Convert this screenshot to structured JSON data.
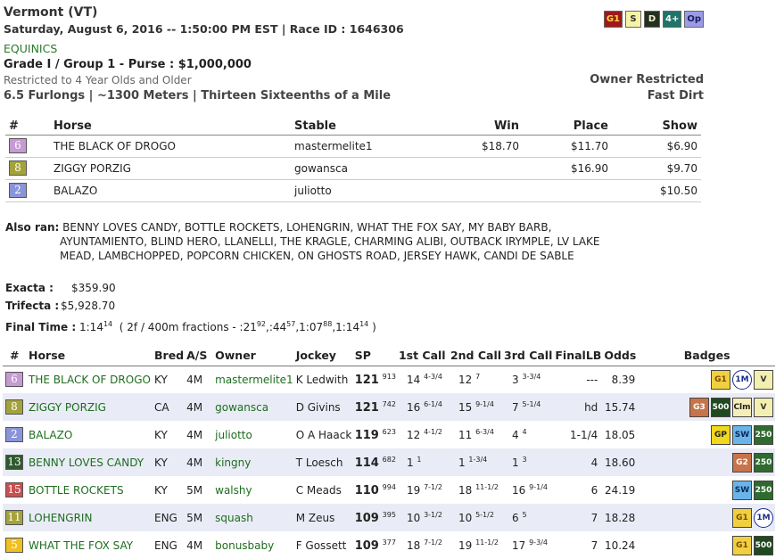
{
  "header": {
    "title": "Vermont (VT)",
    "subtitle": "Saturday, August 6, 2016 -- 1:50:00 PM EST | Race ID : 1646306",
    "grade_badges": [
      {
        "label": "G1",
        "bg": "#a01818",
        "fg": "#ffd24a"
      },
      {
        "label": "S",
        "bg": "#f6f3a6",
        "fg": "#333"
      },
      {
        "label": "D",
        "bg": "#24301e",
        "fg": "#f0f0d0"
      },
      {
        "label": "4+",
        "bg": "#1f7468",
        "fg": "#ffffff"
      },
      {
        "label": "Op",
        "bg": "#9a9ce6",
        "fg": "#1a1a60"
      }
    ],
    "track": "EQUINICS",
    "purse": "Grade I / Group 1 - Purse : $1,000,000",
    "restriction": "Restricted to 4 Year Olds and Older",
    "distance": "6.5 Furlongs | ~1300 Meters | Thirteen Sixteenths of a Mile",
    "owner_restricted": "Owner Restricted",
    "surface": "Fast Dirt"
  },
  "results": {
    "headers": [
      "#",
      "Horse",
      "Stable",
      "Win",
      "Place",
      "Show"
    ],
    "rows": [
      {
        "pp": "6",
        "color": "#c69ad2",
        "horse": "THE BLACK OF DROGO",
        "stable": "mastermelite1",
        "win": "$18.70",
        "place": "$11.70",
        "show": "$6.90"
      },
      {
        "pp": "8",
        "color": "#a4a33a",
        "horse": "ZIGGY PORZIG",
        "stable": "gowansca",
        "win": "",
        "place": "$16.90",
        "show": "$9.70"
      },
      {
        "pp": "2",
        "color": "#8a94d8",
        "horse": "BALAZO",
        "stable": "juliotto",
        "win": "",
        "place": "",
        "show": "$10.50"
      }
    ]
  },
  "also_ran": {
    "label": "Also ran:",
    "lines": [
      "BENNY LOVES CANDY, BOTTLE ROCKETS, LOHENGRIN, WHAT THE FOX SAY, MY BABY BARB,",
      "AYUNTAMIENTO, BLIND HERO, LLANELLI, THE KRAGLE, CHARMING ALIBI, OUTBACK IRYMPLE, LV LAKE",
      "MEAD, LAMBCHOPPED, POPCORN CHICKEN, ON GHOSTS ROAD, JERSEY HAWK, CANDI DE SABLE"
    ]
  },
  "exotics": {
    "exacta_label": "Exacta :",
    "exacta_value": "$359.90",
    "trifecta_label": "Trifecta :",
    "trifecta_value": "$5,928.70"
  },
  "final_time": {
    "label": "Final Time :",
    "time": "1:14",
    "time_sup": "14",
    "fractions_prefix": "( 2f / 400m fractions - :21",
    "f1_sup": "92",
    "f2": ",:44",
    "f2_sup": "57",
    "f3": ",1:07",
    "f3_sup": "88",
    "f4": ",1:14",
    "f4_sup": "14",
    "close": ")"
  },
  "main_table": {
    "headers": [
      "#",
      "Horse",
      "Bred",
      "A/S",
      "Owner",
      "Jockey",
      "SP",
      "1st Call",
      "2nd Call",
      "3rd Call",
      "FinalLB",
      "Odds",
      "Badges"
    ],
    "rows": [
      {
        "pp": "6",
        "color": "#c69ad2",
        "horse": "THE BLACK OF DROGO",
        "bred": "KY",
        "as": "4M",
        "owner": "mastermelite1",
        "jockey": "K Ledwith",
        "sp": "121",
        "sp_sup": "913",
        "c1": "14",
        "c1s": "4-3/4",
        "c2": "12",
        "c2s": "7",
        "c3": "3",
        "c3s": "3-3/4",
        "flb": "---",
        "odds": "8.39",
        "badges": [
          {
            "t": "G1",
            "bg": "#f0d040",
            "fg": "#7a4a00"
          },
          {
            "t": "1M",
            "bg": "#ffffff",
            "fg": "#1a2a8a"
          },
          {
            "t": "V",
            "bg": "#f3efb0",
            "fg": "#333"
          }
        ]
      },
      {
        "pp": "8",
        "color": "#a4a33a",
        "horse": "ZIGGY PORZIG",
        "bred": "CA",
        "as": "4M",
        "owner": "gowansca",
        "jockey": "D Givins",
        "sp": "121",
        "sp_sup": "742",
        "c1": "16",
        "c1s": "6-1/4",
        "c2": "15",
        "c2s": "9-1/4",
        "c3": "7",
        "c3s": "5-1/4",
        "flb": "hd",
        "odds": "15.74",
        "badges": [
          {
            "t": "G3",
            "bg": "#c8744a",
            "fg": "#fff"
          },
          {
            "t": "500",
            "bg": "#1f4a1f",
            "fg": "#fff"
          },
          {
            "t": "Clm",
            "bg": "#f6eeb8",
            "fg": "#222"
          },
          {
            "t": "V",
            "bg": "#f3efb0",
            "fg": "#333"
          }
        ]
      },
      {
        "pp": "2",
        "color": "#8a94d8",
        "horse": "BALAZO",
        "bred": "KY",
        "as": "4M",
        "owner": "juliotto",
        "jockey": "O A Haack",
        "sp": "119",
        "sp_sup": "623",
        "c1": "12",
        "c1s": "4-1/2",
        "c2": "11",
        "c2s": "6-3/4",
        "c3": "4",
        "c3s": "4",
        "flb": "1-1/4",
        "odds": "18.05",
        "badges": [
          {
            "t": "GP",
            "bg": "#f0d81e",
            "fg": "#222"
          },
          {
            "t": "SW",
            "bg": "#6ab4e8",
            "fg": "#0a2a5a"
          },
          {
            "t": "250",
            "bg": "#2f6a2f",
            "fg": "#fff"
          }
        ]
      },
      {
        "pp": "13",
        "color": "#2f5a2f",
        "horse": "BENNY LOVES CANDY",
        "bred": "KY",
        "as": "4M",
        "owner": "kingny",
        "jockey": "T Loesch",
        "sp": "114",
        "sp_sup": "682",
        "c1": "1",
        "c1s": "1",
        "c2": "1",
        "c2s": "1-3/4",
        "c3": "1",
        "c3s": "3",
        "flb": "4",
        "odds": "18.60",
        "badges": [
          {
            "t": "G2",
            "bg": "#c8744a",
            "fg": "#fff"
          },
          {
            "t": "250",
            "bg": "#2f6a2f",
            "fg": "#fff"
          }
        ]
      },
      {
        "pp": "15",
        "color": "#c85050",
        "horse": "BOTTLE ROCKETS",
        "bred": "KY",
        "as": "5M",
        "owner": "walshy",
        "jockey": "C Meads",
        "sp": "110",
        "sp_sup": "994",
        "c1": "19",
        "c1s": "7-1/2",
        "c2": "18",
        "c2s": "11-1/2",
        "c3": "16",
        "c3s": "9-1/4",
        "flb": "6",
        "odds": "24.19",
        "badges": [
          {
            "t": "SW",
            "bg": "#6ab4e8",
            "fg": "#0a2a5a"
          },
          {
            "t": "250",
            "bg": "#2f6a2f",
            "fg": "#fff"
          }
        ]
      },
      {
        "pp": "11",
        "color": "#a4a33a",
        "horse": "LOHENGRIN",
        "bred": "ENG",
        "as": "5M",
        "owner": "squash",
        "jockey": "M Zeus",
        "sp": "109",
        "sp_sup": "395",
        "c1": "10",
        "c1s": "3-1/2",
        "c2": "10",
        "c2s": "5-1/2",
        "c3": "6",
        "c3s": "5",
        "flb": "7",
        "odds": "18.28",
        "badges": [
          {
            "t": "G1",
            "bg": "#f0d040",
            "fg": "#7a4a00"
          },
          {
            "t": "1M",
            "bg": "#ffffff",
            "fg": "#1a2a8a"
          }
        ]
      },
      {
        "pp": "5",
        "color": "#f0c020",
        "horse": "WHAT THE FOX SAY",
        "bred": "ENG",
        "as": "4M",
        "owner": "bonusbaby",
        "jockey": "F Gossett",
        "sp": "109",
        "sp_sup": "377",
        "c1": "18",
        "c1s": "7-1/2",
        "c2": "19",
        "c2s": "11-1/2",
        "c3": "17",
        "c3s": "9-3/4",
        "flb": "7",
        "odds": "10.24",
        "badges": [
          {
            "t": "G1",
            "bg": "#f0d040",
            "fg": "#7a4a00"
          },
          {
            "t": "500",
            "bg": "#1f4a1f",
            "fg": "#fff"
          }
        ]
      }
    ]
  }
}
